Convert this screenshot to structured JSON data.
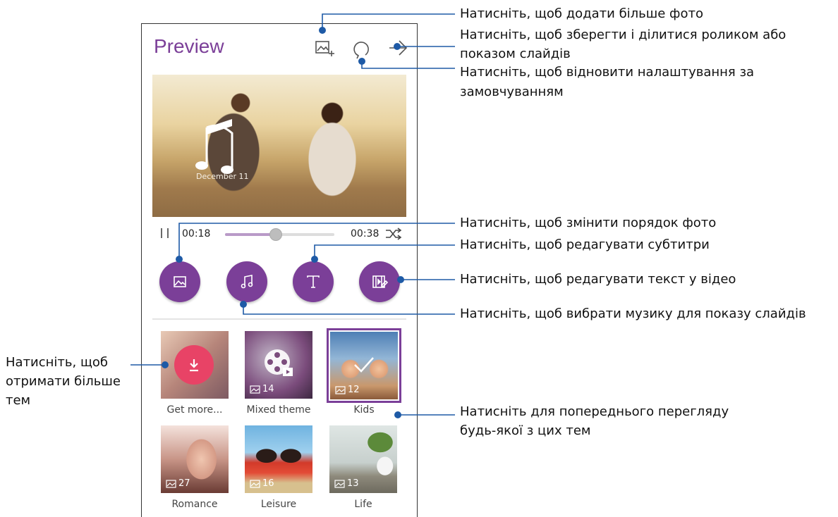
{
  "app": {
    "title": "Preview",
    "photo_caption": "December 11",
    "time_current": "00:18",
    "time_total": "00:38",
    "progress_fraction": 0.46,
    "accent_color": "#7b3f98",
    "icons": {
      "add_photo": "add-photo-icon",
      "reset": "reset-icon",
      "share": "share-arrow-icon",
      "pause": "pause-icon",
      "shuffle": "shuffle-icon",
      "reorder": "image-icon",
      "music": "music-note-icon",
      "subtitles": "text-t-icon",
      "video_text": "video-edit-icon"
    }
  },
  "themes": [
    {
      "label": "Get more...",
      "count": "",
      "icon": "download-icon"
    },
    {
      "label": "Mixed theme",
      "count": "14",
      "icon": "film-reel-icon"
    },
    {
      "label": "Kids",
      "count": "12",
      "selected": true,
      "icon": "check-icon"
    },
    {
      "label": "Romance",
      "count": "27"
    },
    {
      "label": "Leisure",
      "count": "16"
    },
    {
      "label": "Life",
      "count": "13"
    }
  ],
  "annotations": {
    "add_photos": "Натисніть, щоб додати більше фото",
    "save_share_1": "Натисніть, щоб зберегти і ділитися роликом або",
    "save_share_2": "показом слайдів",
    "reset_1": "Натисніть, щоб відновити налаштування за",
    "reset_2": "замовчуванням",
    "reorder": "Натисніть, щоб змінити порядок фото",
    "subtitles": "Натисніть, щоб редагувати субтитри",
    "video_text": "Натисніть, щоб редагувати текст у відео",
    "music": "Натисніть, щоб вибрати музику для показу слайдів",
    "more_themes_1": "Натисніть, щоб",
    "more_themes_2": "отримати більше",
    "more_themes_3": "тем",
    "preview_themes_1": "Натисніть для попереднього перегляду",
    "preview_themes_2": "будь-якої з цих тем"
  }
}
